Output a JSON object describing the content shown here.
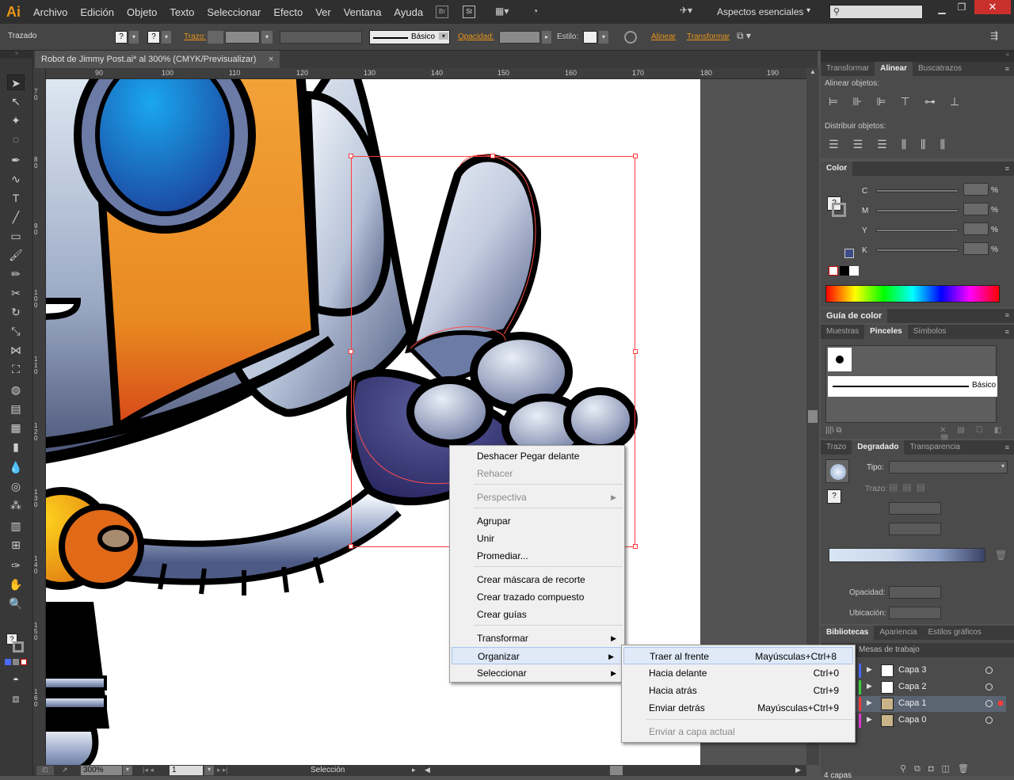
{
  "app": {
    "logo": "Ai"
  },
  "menu": [
    "Archivo",
    "Edición",
    "Objeto",
    "Texto",
    "Seleccionar",
    "Efecto",
    "Ver",
    "Ventana",
    "Ayuda"
  ],
  "workspace": "Aspectos esenciales",
  "control_bar": {
    "object": "Trazado",
    "stroke_label": "Trazo:",
    "brush": "Básico",
    "opacity_label": "Opacidad:",
    "style_label": "Estilo:",
    "align_link": "Alinear",
    "transform_link": "Transformar"
  },
  "document": {
    "title": "Robot de Jimmy Post.ai* al 300% (CMYK/Previsualizar)",
    "close": "×"
  },
  "rulers": {
    "h": [
      "90",
      "100",
      "110",
      "120",
      "130",
      "140",
      "150",
      "160",
      "170",
      "180",
      "190"
    ],
    "v": [
      "70",
      "80",
      "90",
      "100",
      "110",
      "120",
      "130",
      "140",
      "150",
      "160"
    ]
  },
  "status": {
    "zoom": "300%",
    "artboard": "1",
    "tool": "Selección"
  },
  "context_menu": {
    "items": [
      {
        "label": "Deshacer Pegar delante",
        "disabled": false
      },
      {
        "label": "Rehacer",
        "disabled": true
      },
      {
        "label": "Perspectiva",
        "disabled": true,
        "submenu": true
      },
      {
        "label": "Agrupar",
        "disabled": false
      },
      {
        "label": "Unir",
        "disabled": false
      },
      {
        "label": "Promediar...",
        "disabled": false
      },
      {
        "label": "Crear máscara de recorte",
        "disabled": false
      },
      {
        "label": "Crear trazado compuesto",
        "disabled": false
      },
      {
        "label": "Crear guías",
        "disabled": false
      },
      {
        "label": "Transformar",
        "disabled": false,
        "submenu": true
      },
      {
        "label": "Organizar",
        "disabled": false,
        "submenu": true,
        "highlighted": true
      },
      {
        "label": "Seleccionar",
        "disabled": false,
        "submenu": true
      }
    ]
  },
  "submenu": {
    "items": [
      {
        "label": "Traer al frente",
        "shortcut": "Mayúsculas+Ctrl+8"
      },
      {
        "label": "Hacia delante",
        "shortcut": "Ctrl+0"
      },
      {
        "label": "Hacia atrás",
        "shortcut": "Ctrl+9"
      },
      {
        "label": "Enviar detrás",
        "shortcut": "Mayúsculas+Ctrl+9"
      },
      {
        "label": "Enviar a capa actual",
        "shortcut": ""
      }
    ]
  },
  "panels": {
    "align_tabs": [
      "Transformar",
      "Alinear",
      "Buscatrazos"
    ],
    "align_objects": "Alinear objetos:",
    "distribute_objects": "Distribuir objetos:",
    "color_title": "Color",
    "color_channels": [
      "C",
      "M",
      "Y",
      "K"
    ],
    "pct": "%",
    "color_guide": "Guía de color",
    "swatch_tabs": [
      "Muestras",
      "Pinceles",
      "Símbolos"
    ],
    "brush_name": "Básico",
    "gradient_tabs": [
      "Trazo",
      "Degradado",
      "Transparencia"
    ],
    "gradient_type": "Tipo:",
    "gradient_stroke": "Trazo:",
    "gradient_opacity": "Opacidad:",
    "gradient_location": "Ubicación:",
    "layers_tabs": [
      "Bibliotecas",
      "Apariencia",
      "Estilos gráficos"
    ],
    "artboards_tab": "Mesas de trabajo",
    "layers": [
      {
        "name": "Capa 3",
        "color": "#4b6bff"
      },
      {
        "name": "Capa 2",
        "color": "#3ed33e"
      },
      {
        "name": "Capa 1",
        "color": "#ff3b3b",
        "selected": true
      },
      {
        "name": "Capa 0",
        "color": "#e03bd6"
      }
    ],
    "layer_count": "4 capas"
  }
}
